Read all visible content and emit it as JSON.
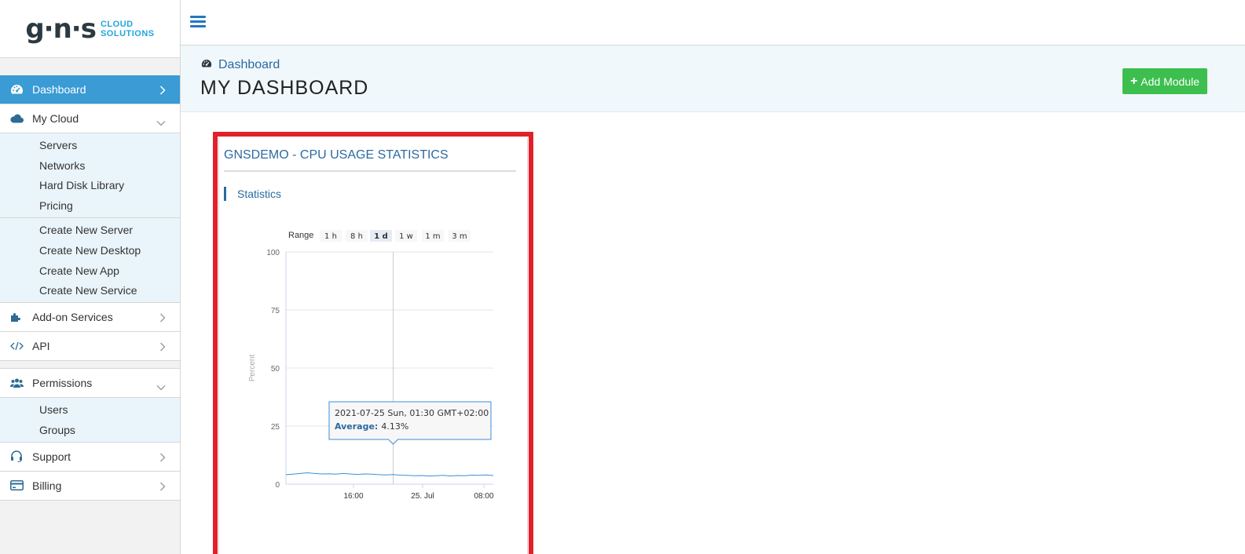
{
  "logo": {
    "mark": "g·n·s",
    "line1": "CLOUD",
    "line2": "SOLUTIONS"
  },
  "sidebar": {
    "dashboard": "Dashboard",
    "my_cloud": "My Cloud",
    "my_cloud_items": [
      "Servers",
      "Networks",
      "Hard Disk Library",
      "Pricing"
    ],
    "create_items": [
      "Create New Server",
      "Create New Desktop",
      "Create New App",
      "Create New Service"
    ],
    "addons": "Add-on Services",
    "api": "API",
    "permissions": "Permissions",
    "permission_items": [
      "Users",
      "Groups"
    ],
    "support": "Support",
    "billing": "Billing"
  },
  "header": {
    "breadcrumb": "Dashboard",
    "title": "MY DASHBOARD",
    "add_module": "Add Module"
  },
  "module": {
    "title": "GNSDEMO - CPU USAGE STATISTICS",
    "section": "Statistics"
  },
  "range_selector": {
    "label": "Range",
    "buttons": [
      "1 h",
      "8 h",
      "1 d",
      "1 w",
      "1 m",
      "3 m"
    ],
    "selected": "1 d"
  },
  "chart_data": {
    "type": "line",
    "ylabel": "Percent",
    "ylim": [
      0,
      100
    ],
    "yticks": [
      0,
      25,
      50,
      75,
      100
    ],
    "xticks": [
      "16:00",
      "25. Jul",
      "08:00"
    ],
    "series": [
      {
        "name": "Average",
        "color": "#3b8fd9",
        "values": [
          4.1,
          4.3,
          4.6,
          4.9,
          4.6,
          4.4,
          4.5,
          4.3,
          4.6,
          4.4,
          4.2,
          4.4,
          4.3,
          4.1,
          4.0,
          4.13,
          3.9,
          3.8,
          3.6,
          3.7,
          3.5,
          3.6,
          3.8,
          3.5,
          3.7,
          3.6,
          3.9,
          3.8,
          4.0,
          3.7
        ]
      }
    ],
    "tooltip": {
      "date": "2021-07-25 Sun, 01:30 GMT+02:00",
      "series": "Average:",
      "value": "4.13%"
    }
  }
}
